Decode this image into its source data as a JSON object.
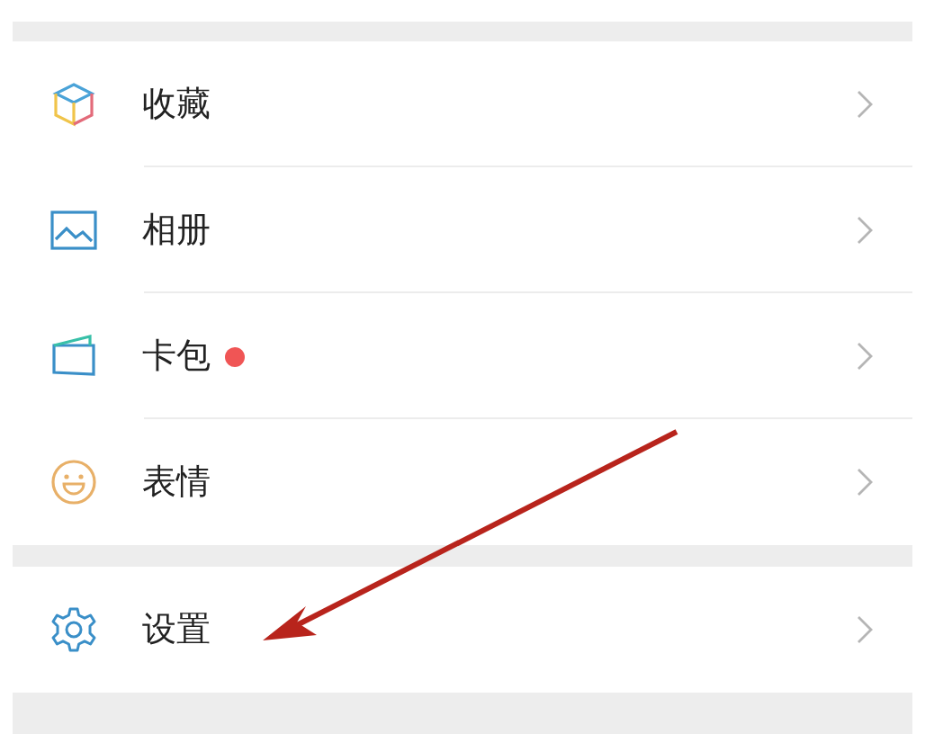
{
  "sections": [
    {
      "items": [
        {
          "label": "收藏",
          "badge": false
        },
        {
          "label": "相册",
          "badge": false
        },
        {
          "label": "卡包",
          "badge": true
        },
        {
          "label": "表情",
          "badge": false
        }
      ]
    },
    {
      "items": [
        {
          "label": "设置",
          "badge": false
        }
      ]
    }
  ]
}
